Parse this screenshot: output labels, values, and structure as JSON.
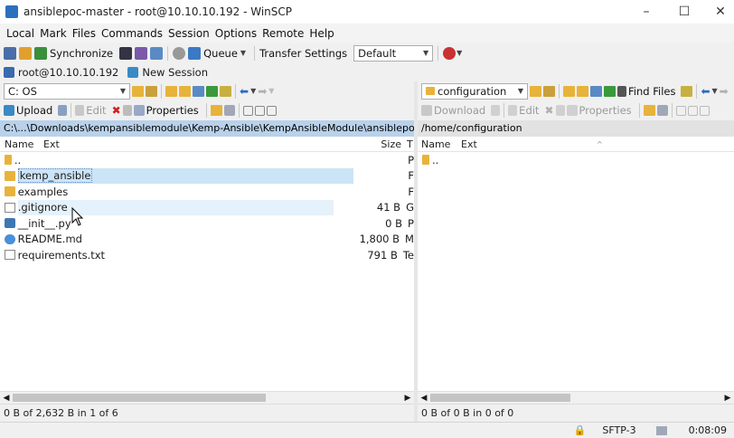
{
  "window": {
    "title": "ansiblepoc-master - root@10.10.10.192 - WinSCP",
    "minimize": "–",
    "maximize": "☐",
    "close": "✕"
  },
  "menu": [
    "Local",
    "Mark",
    "Files",
    "Commands",
    "Session",
    "Options",
    "Remote",
    "Help"
  ],
  "toolbar": {
    "synchronize": "Synchronize",
    "queue": "Queue",
    "transfer_settings": "Transfer Settings",
    "transfer_default": "Default"
  },
  "session": {
    "tab": "root@10.10.10.192",
    "new": "New Session"
  },
  "local": {
    "drive": "C: OS",
    "upload": "Upload",
    "edit": "Edit",
    "properties": "Properties",
    "path": "C:\\...\\Downloads\\kempansiblemodule\\Kemp-Ansible\\KempAnsibleModule\\ansiblepoc-master",
    "col_name": "Name",
    "col_ext": "Ext",
    "col_size": "Size",
    "col_type": "T",
    "files": [
      {
        "name": "..",
        "size": "",
        "type": "P",
        "icon": "up"
      },
      {
        "name": "kemp_ansible",
        "size": "",
        "type": "F",
        "icon": "folder"
      },
      {
        "name": "examples",
        "size": "",
        "type": "F",
        "icon": "folder"
      },
      {
        "name": ".gitignore",
        "size": "41 B",
        "type": "G",
        "icon": "doc"
      },
      {
        "name": "__init__.py",
        "size": "0 B",
        "type": "P",
        "icon": "py"
      },
      {
        "name": "README.md",
        "size": "1,800 B",
        "type": "M",
        "icon": "md"
      },
      {
        "name": "requirements.txt",
        "size": "791 B",
        "type": "Te",
        "icon": "doc"
      }
    ],
    "status": "0 B of 2,632 B in 1 of 6"
  },
  "remote": {
    "folder": "configuration",
    "find_files": "Find Files",
    "download": "Download",
    "edit": "Edit",
    "properties": "Properties",
    "path": "/home/configuration",
    "col_name": "Name",
    "col_ext": "Ext",
    "files": [
      {
        "name": "..",
        "icon": "up"
      }
    ],
    "status": "0 B of 0 B in 0 of 0"
  },
  "bottom": {
    "protocol": "SFTP-3",
    "time": "0:08:09"
  }
}
